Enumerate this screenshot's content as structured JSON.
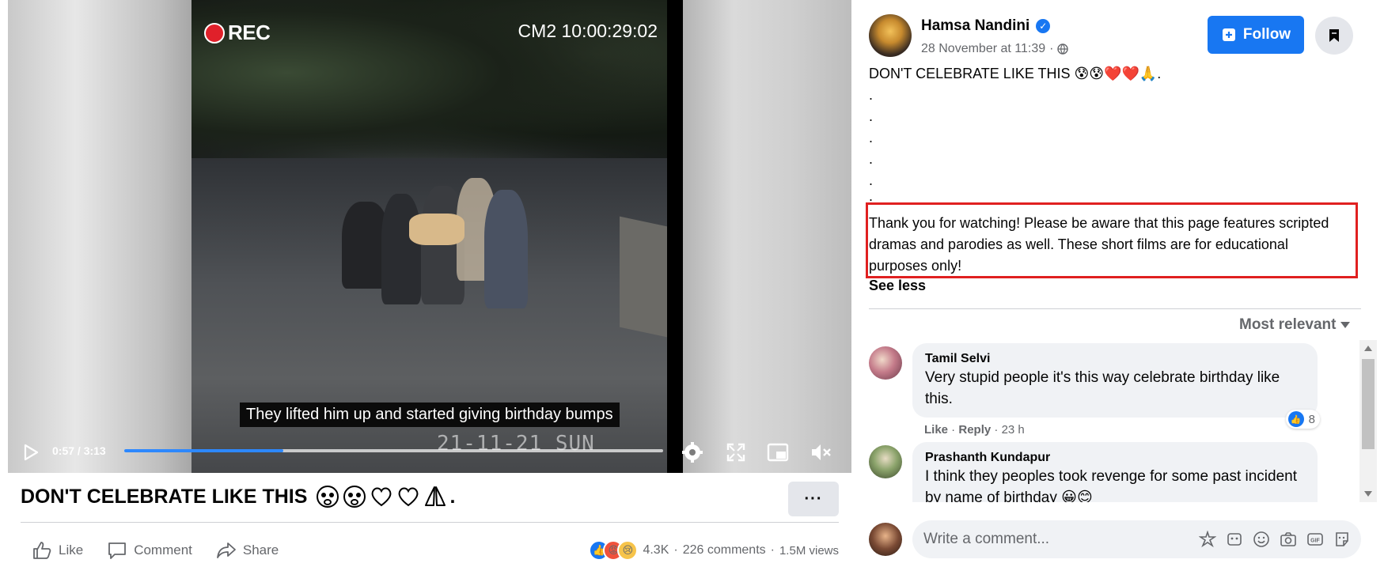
{
  "video": {
    "rec_label": "REC",
    "timecode": "CM2 10:00:29:02",
    "subtitle": "They lifted him up and started giving birthday bumps",
    "datestamp": "21-11-21 SUN",
    "time_display": "0:57 / 3:13",
    "progress_fraction": 0.295
  },
  "post": {
    "title": "DON'T CELEBRATE LIKE THIS",
    "title_suffix": ".",
    "more_label": "···",
    "actions": {
      "like": "Like",
      "comment": "Comment",
      "share": "Share"
    },
    "stats": {
      "reactions": "4.3K",
      "sep1": "·",
      "comments": "226 comments",
      "sep2": "·",
      "views": "1.5M views"
    }
  },
  "panel": {
    "author": "Hamsa Nandini",
    "timestamp": "28 November at 11:39",
    "meta_sep": "·",
    "follow_label": "Follow",
    "caption_first": "DON'T CELEBRATE LIKE THIS 😰😰❤️❤️🙏.",
    "caption_dots": [
      ".",
      ".",
      ".",
      ".",
      ".",
      "."
    ],
    "disclaimer": "Thank you for watching! Please be aware that this page features scripted dramas and parodies as well. These short films are for educational purposes only!",
    "see_less": "See less",
    "sort_label": "Most relevant",
    "comments": [
      {
        "name": "Tamil Selvi",
        "text": "Very stupid people it's this way celebrate birthday like this.",
        "like": "Like",
        "reply": "Reply",
        "age": "23 h",
        "reaction_count": "8"
      },
      {
        "name": "Prashanth Kundapur",
        "text": "I think they peoples took revenge for some past incident by name of birthday 😀😊"
      }
    ],
    "write_placeholder": "Write a comment..."
  },
  "colors": {
    "brand_blue": "#1877f2",
    "highlight_red": "#e02020",
    "muted_text": "#65676b",
    "bubble_bg": "#f0f2f5"
  }
}
